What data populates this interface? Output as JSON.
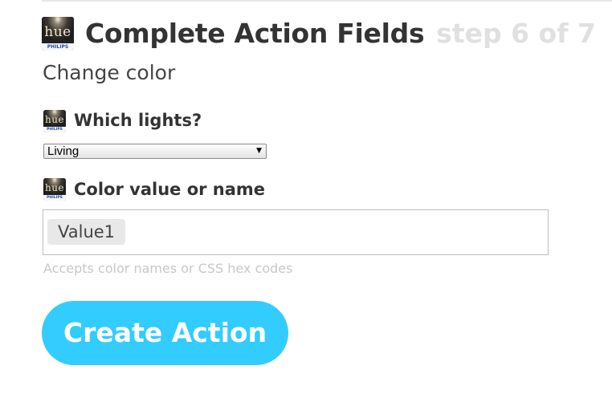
{
  "header": {
    "title": "Complete Action Fields",
    "step": "step 6 of 7",
    "logo": {
      "icon": "philips-hue-logo-icon",
      "wordmark": "hue",
      "brand": "PHILIPS"
    }
  },
  "action": {
    "name": "Change color"
  },
  "fields": [
    {
      "label": "Which lights?",
      "type": "select",
      "value": "Living"
    },
    {
      "label": "Color value or name",
      "type": "text",
      "ingredient": "Value1",
      "helper": "Accepts color names or CSS hex codes"
    }
  ],
  "submit": {
    "label": "Create Action"
  },
  "colors": {
    "accent": "#33ccff",
    "title": "#333333",
    "step": "#e0e0e0",
    "helper": "#c8c8c8"
  }
}
